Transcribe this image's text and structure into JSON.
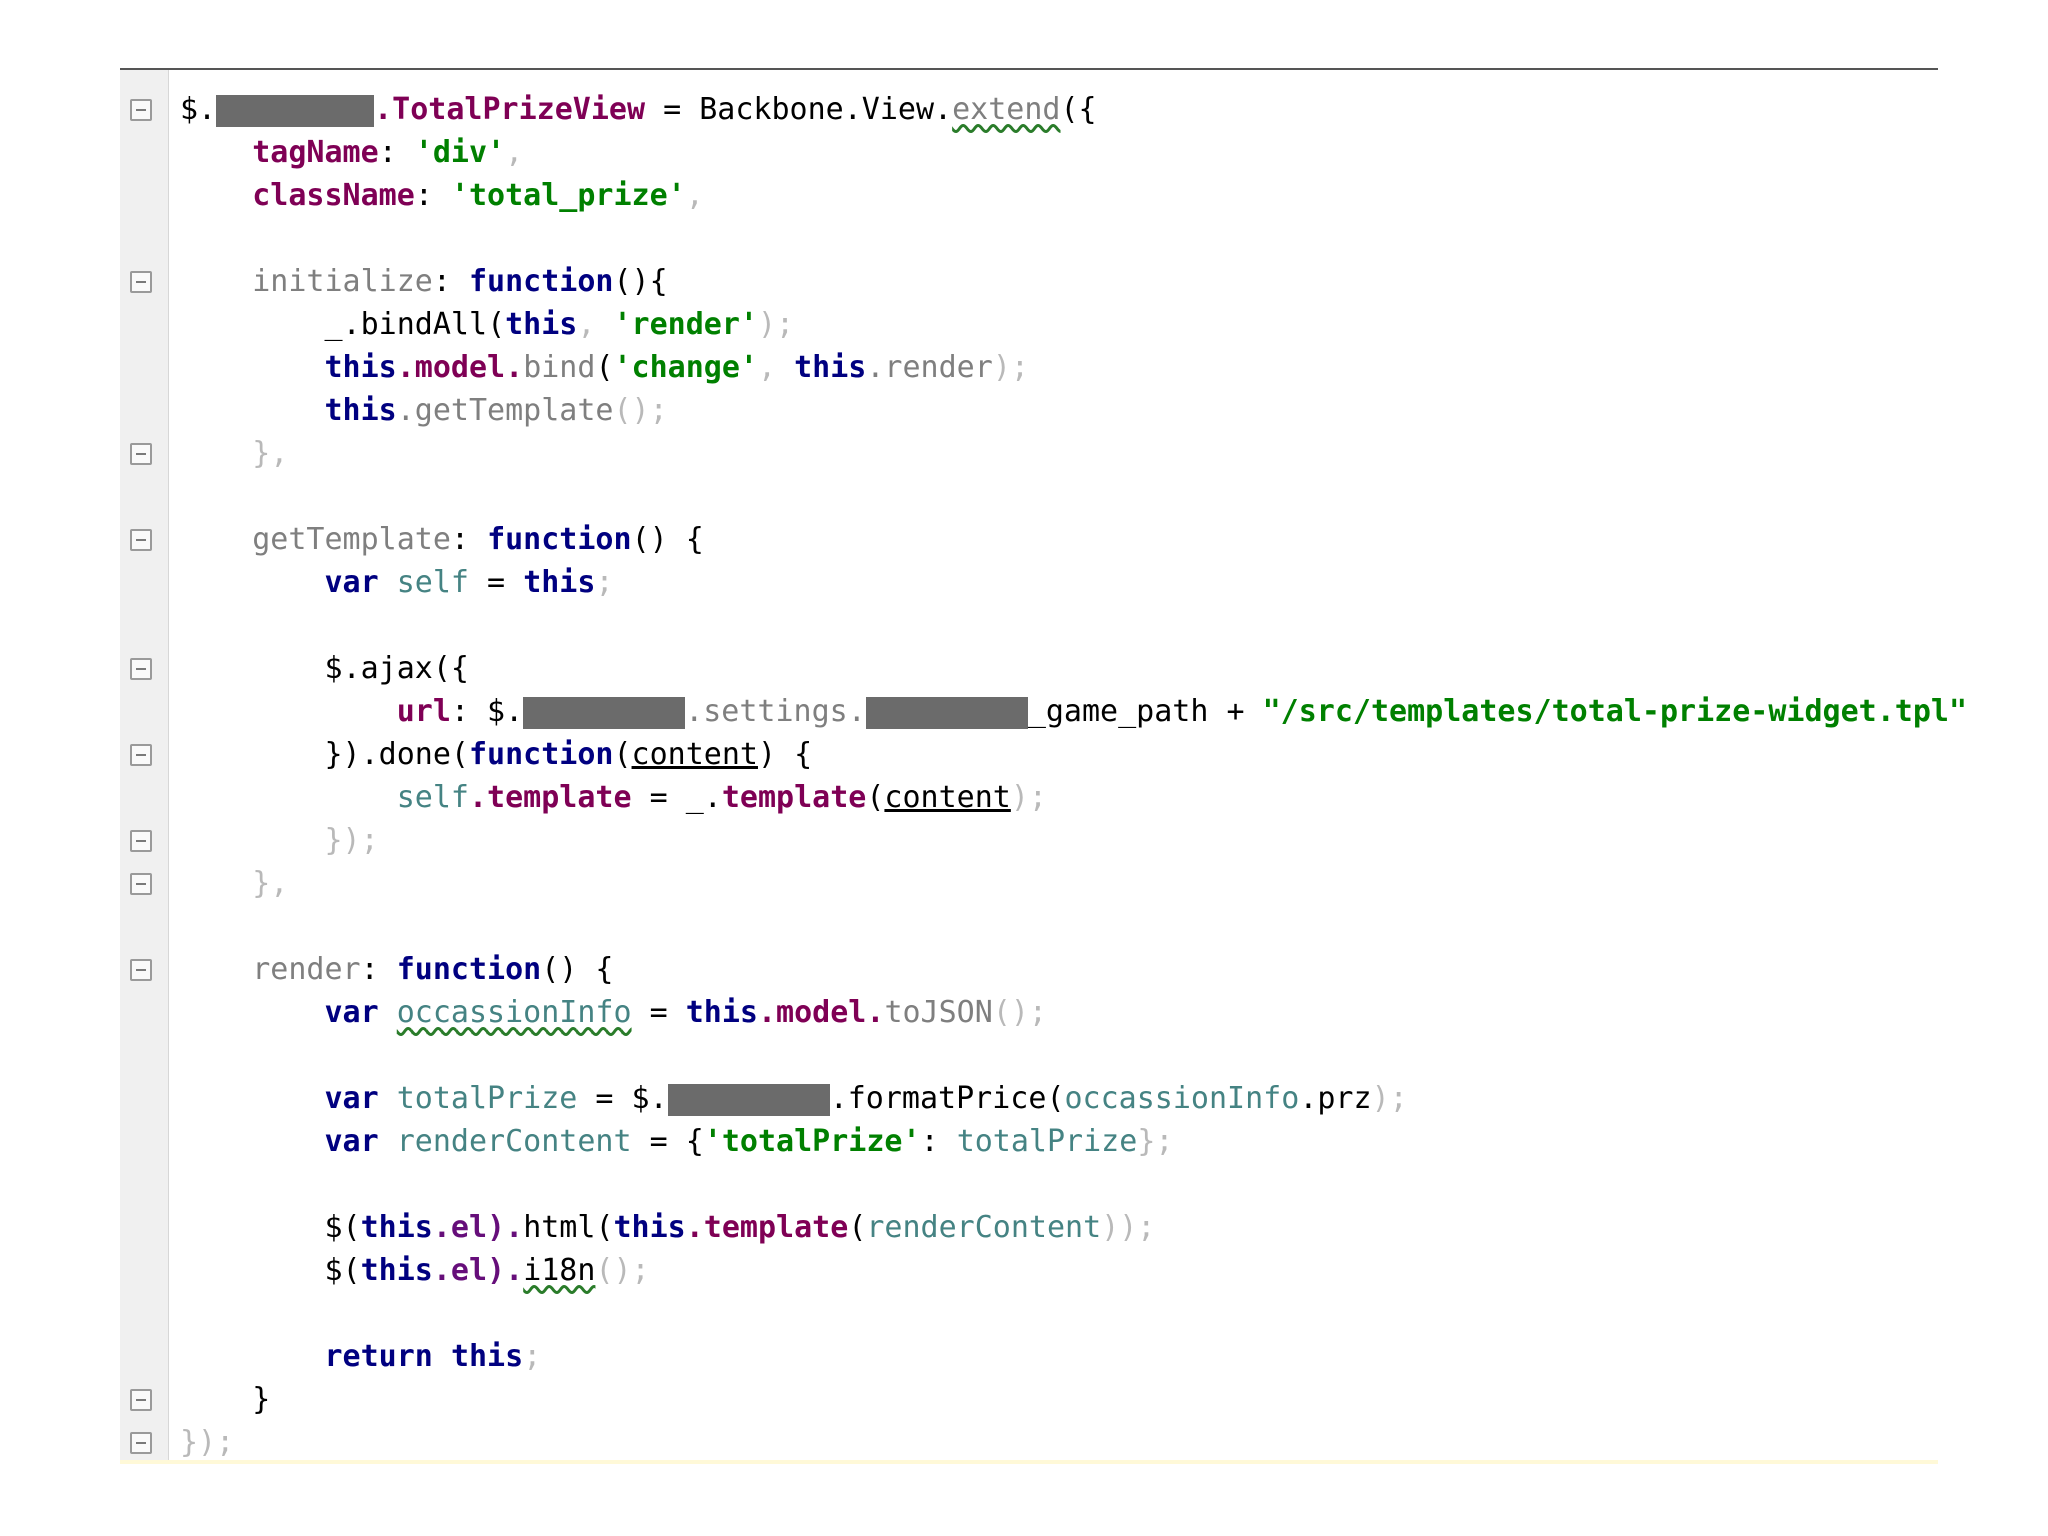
{
  "code": {
    "lines": [
      [
        {
          "text": "$.",
          "cls": "dark"
        },
        {
          "redact": true,
          "w": 158
        },
        {
          "text": ".TotalPrizeView",
          "cls": "prop"
        },
        {
          "text": " = ",
          "cls": "dark"
        },
        {
          "text": "Backbone",
          "cls": "dark"
        },
        {
          "text": ".View.",
          "cls": "dark"
        },
        {
          "text": "extend",
          "cls": "fn wave"
        },
        {
          "text": "({",
          "cls": "dark"
        }
      ],
      [
        {
          "text": "    tagName",
          "cls": "prop"
        },
        {
          "text": ": ",
          "cls": "dark"
        },
        {
          "text": "'div'",
          "cls": "str"
        },
        {
          "text": ",",
          "cls": "muted"
        }
      ],
      [
        {
          "text": "    className",
          "cls": "prop"
        },
        {
          "text": ": ",
          "cls": "dark"
        },
        {
          "text": "'total_prize'",
          "cls": "str"
        },
        {
          "text": ",",
          "cls": "muted"
        }
      ],
      [],
      [
        {
          "text": "    initialize",
          "cls": "fn"
        },
        {
          "text": ": ",
          "cls": "dark"
        },
        {
          "text": "function",
          "cls": "kw"
        },
        {
          "text": "(){",
          "cls": "dark"
        }
      ],
      [
        {
          "text": "        _",
          "cls": "dark"
        },
        {
          "text": ".bindAll",
          "cls": "dark"
        },
        {
          "text": "(",
          "cls": "dark"
        },
        {
          "text": "this",
          "cls": "kw"
        },
        {
          "text": ", ",
          "cls": "muted"
        },
        {
          "text": "'render'",
          "cls": "str"
        },
        {
          "text": ");",
          "cls": "muted"
        }
      ],
      [
        {
          "text": "        this",
          "cls": "kw"
        },
        {
          "text": ".model.",
          "cls": "prop"
        },
        {
          "text": "bind",
          "cls": "fn"
        },
        {
          "text": "(",
          "cls": "dark"
        },
        {
          "text": "'change'",
          "cls": "str"
        },
        {
          "text": ", ",
          "cls": "muted"
        },
        {
          "text": "this",
          "cls": "kw"
        },
        {
          "text": ".render",
          "cls": "fn"
        },
        {
          "text": ");",
          "cls": "muted"
        }
      ],
      [
        {
          "text": "        this",
          "cls": "kw"
        },
        {
          "text": ".getTemplate",
          "cls": "fn"
        },
        {
          "text": "();",
          "cls": "muted"
        }
      ],
      [
        {
          "text": "    },",
          "cls": "muted"
        }
      ],
      [],
      [
        {
          "text": "    getTemplate",
          "cls": "fn"
        },
        {
          "text": ": ",
          "cls": "dark"
        },
        {
          "text": "function",
          "cls": "kw"
        },
        {
          "text": "() {",
          "cls": "dark"
        }
      ],
      [
        {
          "text": "        var ",
          "cls": "kw"
        },
        {
          "text": "self",
          "cls": "id"
        },
        {
          "text": " = ",
          "cls": "dark"
        },
        {
          "text": "this",
          "cls": "kw"
        },
        {
          "text": ";",
          "cls": "muted"
        }
      ],
      [],
      [
        {
          "text": "        $",
          "cls": "dark"
        },
        {
          "text": ".ajax",
          "cls": "dark"
        },
        {
          "text": "({",
          "cls": "dark"
        }
      ],
      [
        {
          "text": "            url",
          "cls": "prop"
        },
        {
          "text": ": $.",
          "cls": "dark"
        },
        {
          "redact": true,
          "w": 162
        },
        {
          "text": ".settings.",
          "cls": "fn"
        },
        {
          "redact": true,
          "w": 162
        },
        {
          "text": "_game_path",
          "cls": "dark"
        },
        {
          "text": " + ",
          "cls": "dark"
        },
        {
          "text": "\"/src/templates/total-prize-widget.tpl\"",
          "cls": "str"
        }
      ],
      [
        {
          "text": "        }).done(",
          "cls": "dark"
        },
        {
          "text": "function",
          "cls": "kw"
        },
        {
          "text": "(",
          "cls": "dark"
        },
        {
          "text": "content",
          "cls": "dark u"
        },
        {
          "text": ") {",
          "cls": "dark"
        }
      ],
      [
        {
          "text": "            self",
          "cls": "id"
        },
        {
          "text": ".template",
          "cls": "prop"
        },
        {
          "text": " = ",
          "cls": "dark"
        },
        {
          "text": "_.",
          "cls": "dark"
        },
        {
          "text": "template",
          "cls": "prop"
        },
        {
          "text": "(",
          "cls": "dark"
        },
        {
          "text": "content",
          "cls": "dark u"
        },
        {
          "text": ");",
          "cls": "muted"
        }
      ],
      [
        {
          "text": "        });",
          "cls": "muted"
        }
      ],
      [
        {
          "text": "    },",
          "cls": "muted"
        }
      ],
      [],
      [
        {
          "text": "    render",
          "cls": "fn"
        },
        {
          "text": ": ",
          "cls": "dark"
        },
        {
          "text": "function",
          "cls": "kw"
        },
        {
          "text": "() {",
          "cls": "dark"
        }
      ],
      [
        {
          "text": "        var ",
          "cls": "kw"
        },
        {
          "text": "occassionInfo",
          "cls": "id wave"
        },
        {
          "text": " = ",
          "cls": "dark"
        },
        {
          "text": "this",
          "cls": "kw"
        },
        {
          "text": ".model.",
          "cls": "prop"
        },
        {
          "text": "toJSON",
          "cls": "fn"
        },
        {
          "text": "();",
          "cls": "muted"
        }
      ],
      [],
      [
        {
          "text": "        var ",
          "cls": "kw"
        },
        {
          "text": "totalPrize",
          "cls": "id"
        },
        {
          "text": " = $.",
          "cls": "dark"
        },
        {
          "redact": true,
          "w": 162
        },
        {
          "text": ".formatPrice",
          "cls": "dark"
        },
        {
          "text": "(",
          "cls": "dark"
        },
        {
          "text": "occassionInfo",
          "cls": "id"
        },
        {
          "text": ".prz",
          "cls": "dark"
        },
        {
          "text": ");",
          "cls": "muted"
        }
      ],
      [
        {
          "text": "        var ",
          "cls": "kw"
        },
        {
          "text": "renderContent",
          "cls": "id"
        },
        {
          "text": " = {",
          "cls": "dark"
        },
        {
          "text": "'totalPrize'",
          "cls": "str"
        },
        {
          "text": ": ",
          "cls": "dark"
        },
        {
          "text": "totalPrize",
          "cls": "id"
        },
        {
          "text": "};",
          "cls": "muted"
        }
      ],
      [],
      [
        {
          "text": "        $(",
          "cls": "dark"
        },
        {
          "text": "this",
          "cls": "kw"
        },
        {
          "text": ".el).",
          "cls": "purple"
        },
        {
          "text": "html",
          "cls": "dark"
        },
        {
          "text": "(",
          "cls": "dark"
        },
        {
          "text": "this",
          "cls": "kw"
        },
        {
          "text": ".template",
          "cls": "prop"
        },
        {
          "text": "(",
          "cls": "dark"
        },
        {
          "text": "renderContent",
          "cls": "id"
        },
        {
          "text": "));",
          "cls": "muted"
        }
      ],
      [
        {
          "text": "        $(",
          "cls": "dark"
        },
        {
          "text": "this",
          "cls": "kw"
        },
        {
          "text": ".el).",
          "cls": "purple"
        },
        {
          "text": "i18n",
          "cls": "dark wave"
        },
        {
          "text": "();",
          "cls": "muted"
        }
      ],
      [],
      [
        {
          "text": "        return ",
          "cls": "kw"
        },
        {
          "text": "this",
          "cls": "kw"
        },
        {
          "text": ";",
          "cls": "muted"
        }
      ],
      [
        {
          "text": "    }",
          "cls": "dark"
        }
      ],
      [
        {
          "text": "});",
          "cls": "muted"
        }
      ]
    ],
    "fold_lines": [
      0,
      4,
      8,
      10,
      13,
      15,
      17,
      18,
      20,
      30,
      31
    ]
  }
}
